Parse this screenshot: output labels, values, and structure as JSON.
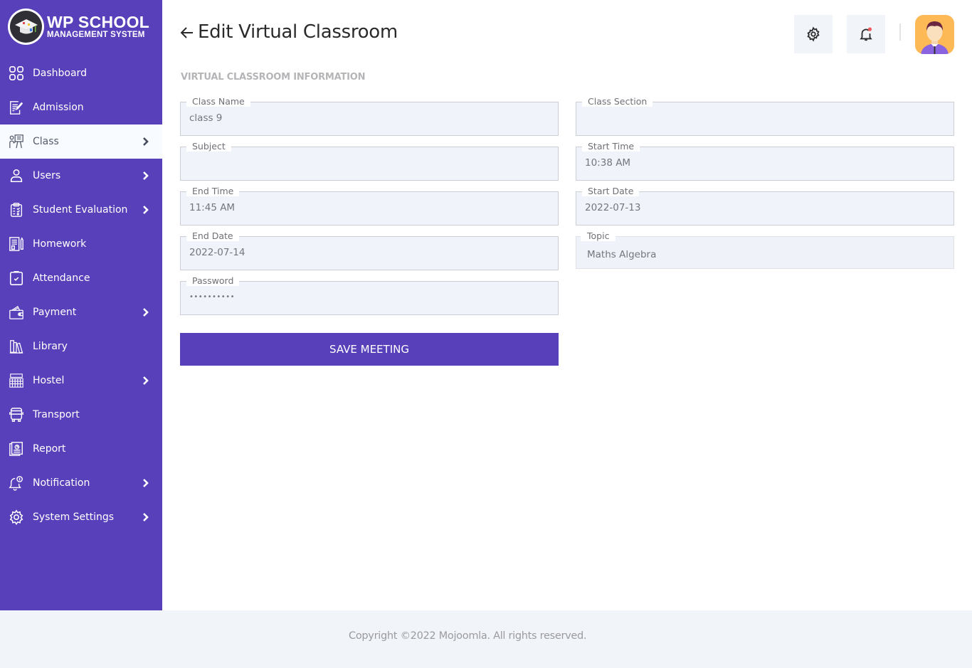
{
  "app": {
    "logo_title": "WP SCHOOL",
    "logo_subtitle": "MANAGEMENT SYSTEM"
  },
  "sidebar": {
    "items": [
      {
        "label": "Dashboard",
        "icon": "dashboard-icon",
        "has_submenu": false,
        "active": false
      },
      {
        "label": "Admission",
        "icon": "admission-icon",
        "has_submenu": false,
        "active": false
      },
      {
        "label": "Class",
        "icon": "class-icon",
        "has_submenu": true,
        "active": true
      },
      {
        "label": "Users",
        "icon": "user-icon",
        "has_submenu": true,
        "active": false
      },
      {
        "label": "Student Evaluation",
        "icon": "evaluation-icon",
        "has_submenu": true,
        "active": false
      },
      {
        "label": "Homework",
        "icon": "homework-icon",
        "has_submenu": false,
        "active": false
      },
      {
        "label": "Attendance",
        "icon": "attendance-icon",
        "has_submenu": false,
        "active": false
      },
      {
        "label": "Payment",
        "icon": "wallet-icon",
        "has_submenu": true,
        "active": false
      },
      {
        "label": "Library",
        "icon": "library-icon",
        "has_submenu": false,
        "active": false
      },
      {
        "label": "Hostel",
        "icon": "hostel-icon",
        "has_submenu": true,
        "active": false
      },
      {
        "label": "Transport",
        "icon": "bus-icon",
        "has_submenu": false,
        "active": false
      },
      {
        "label": "Report",
        "icon": "report-icon",
        "has_submenu": false,
        "active": false
      },
      {
        "label": "Notification",
        "icon": "notification-icon",
        "has_submenu": true,
        "active": false
      },
      {
        "label": "System Settings",
        "icon": "settings-icon",
        "has_submenu": true,
        "active": false
      }
    ]
  },
  "header": {
    "title": "Edit Virtual Classroom",
    "back_icon": "arrow-left-icon",
    "settings_icon": "gear-icon",
    "notification_icon": "bell-icon"
  },
  "form": {
    "section_title": "VIRTUAL CLASSROOM INFORMATION",
    "fields": {
      "class_name": {
        "label": "Class Name",
        "value": "class 9"
      },
      "class_section": {
        "label": "Class Section",
        "value": ""
      },
      "subject": {
        "label": "Subject",
        "value": ""
      },
      "start_time": {
        "label": "Start Time",
        "value": "10:38 AM"
      },
      "end_time": {
        "label": "End Time",
        "value": "11:45 AM"
      },
      "start_date": {
        "label": "Start Date",
        "value": "2022-07-13"
      },
      "end_date": {
        "label": "End Date",
        "value": "2022-07-14"
      },
      "topic": {
        "label": "Topic",
        "value": "Maths Algebra"
      },
      "password": {
        "label": "Password",
        "value": "••••••••••"
      }
    },
    "save_label": "SAVE MEETING"
  },
  "footer": {
    "copyright": "Copyright ©2022 Mojoomla. All rights reserved."
  },
  "colors": {
    "brand": "#5840bb",
    "field_bg": "#f0f3f9",
    "footer_bg": "#f1f4f9",
    "notification_dot": "#f05a5a"
  }
}
